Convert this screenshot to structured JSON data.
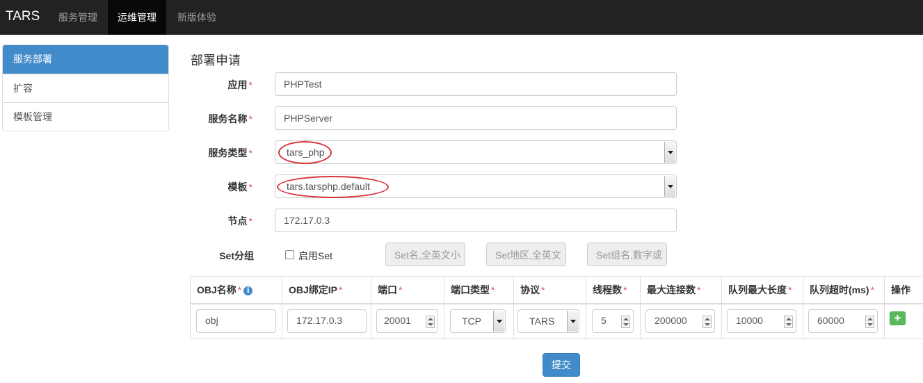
{
  "navbar": {
    "brand": "TARS",
    "items": [
      {
        "label": "服务管理",
        "active": false
      },
      {
        "label": "运维管理",
        "active": true
      },
      {
        "label": "新版体验",
        "active": false
      }
    ]
  },
  "sidebar": {
    "items": [
      {
        "label": "服务部署",
        "active": true
      },
      {
        "label": "扩容",
        "active": false
      },
      {
        "label": "模板管理",
        "active": false
      }
    ]
  },
  "form": {
    "title": "部署申请",
    "required_mark": "*",
    "app": {
      "label": "应用",
      "value": "PHPTest"
    },
    "server_name": {
      "label": "服务名称",
      "value": "PHPServer"
    },
    "server_type": {
      "label": "服务类型",
      "value": "tars_php"
    },
    "template": {
      "label": "模板",
      "value": "tars.tarsphp.default"
    },
    "node": {
      "label": "节点",
      "value": "172.17.0.3"
    },
    "set": {
      "label": "Set分组",
      "enable_label": "启用Set",
      "enabled": false,
      "name_placeholder": "Set名,全英文小",
      "area_placeholder": "Set地区,全英文",
      "group_placeholder": "Set组名,数字或"
    }
  },
  "obj_table": {
    "headers": [
      {
        "label": "OBJ名称",
        "mark": "*"
      },
      {
        "label": "OBJ绑定IP",
        "mark": "*"
      },
      {
        "label": "端口",
        "mark": "*"
      },
      {
        "label": "端口类型",
        "mark": "*"
      },
      {
        "label": "协议",
        "mark": "*"
      },
      {
        "label": "线程数",
        "mark": "*"
      },
      {
        "label": "最大连接数",
        "mark": "*"
      },
      {
        "label": "队列最大长度",
        "mark": "*"
      },
      {
        "label": "队列超时(ms)",
        "mark": "*"
      },
      {
        "label": "操作",
        "mark": ""
      }
    ],
    "info_icon": "info-icon",
    "row": {
      "obj_name": "obj",
      "bind_ip": "172.17.0.3",
      "port": "20001",
      "port_type": "TCP",
      "protocol": "TARS",
      "threads": "5",
      "max_connections": "200000",
      "queue_cap": "10000",
      "queue_timeout": "60000",
      "add_icon": "plus-icon",
      "add_symbol": "+"
    }
  },
  "submit_label": "提交",
  "colors": {
    "navbar_bg": "#222222",
    "primary": "#428bca",
    "success": "#5cb85c",
    "required": "#d9534f",
    "annotation_circle": "#d8333a"
  }
}
